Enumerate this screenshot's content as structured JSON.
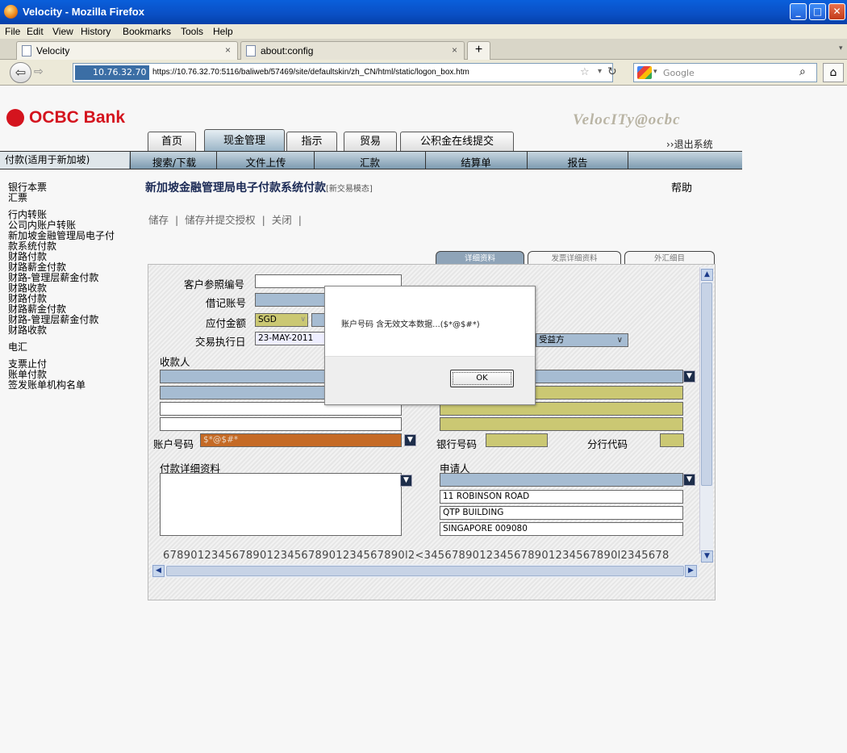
{
  "window": {
    "title": "Velocity - Mozilla Firefox"
  },
  "menu": [
    "File",
    "Edit",
    "View",
    "History",
    "Bookmarks",
    "Tools",
    "Help"
  ],
  "tabs": [
    {
      "label": "Velocity",
      "close": "×"
    },
    {
      "label": "about:config",
      "close": "×"
    }
  ],
  "new_tab": "+",
  "nav": {
    "site_id": "10.76.32.70",
    "url": "https://10.76.32.70:5116/baliweb/57469/site/defaultskin/zh_CN/html/static/logon_box.htm",
    "search_placeholder": "Google"
  },
  "brand": {
    "bank": "OCBC Bank",
    "product": "VelocITy@ocbc"
  },
  "main_tabs": [
    "首页",
    "现金管理",
    "指示",
    "贸易",
    "公积金在线提交"
  ],
  "logout": "››退出系统",
  "subnav": [
    "付款(适用于新加坡)",
    "搜索/下载",
    "文件上传",
    "汇款",
    "结算单",
    "报告"
  ],
  "left_menu": [
    "银行本票",
    "汇票",
    "",
    "行内转账",
    "公司内账户转账",
    "新加坡金融管理局电子付",
    "款系统付款",
    "财路付款",
    "财路薪金付款",
    "财路-管理层薪金付款",
    "财路收款",
    "财路付款",
    "财路薪金付款",
    "财路-管理层薪金付款",
    "财路收款",
    "",
    "电汇",
    "",
    "支票止付",
    "账单付款",
    "签发账单机构名单"
  ],
  "page": {
    "title": "新加坡金融管理局电子付款系统付款",
    "status": "[新交易模态]",
    "help": "帮助"
  },
  "actions": [
    "储存",
    "储存并提交授权",
    "关闭"
  ],
  "content_tabs": [
    "详细资料",
    "发票详细资料",
    "外汇细目"
  ],
  "form": {
    "customer_ref_label": "客户参照编号",
    "debit_account_label": "借记账号",
    "amount_label": "应付金额",
    "currency": "SGD",
    "exec_date_label": "交易执行日",
    "exec_date": "23-MAY-2011",
    "charges_value": "受益方",
    "payee_label": "收款人",
    "account_no_label": "账户号码",
    "account_no_value": "$*@$#*",
    "bank_code_label": "银行号码",
    "branch_code_label": "分行代码",
    "payment_details_label": "付款详细资料",
    "applicant_label": "申请人",
    "applicant_address": [
      "11 ROBINSON ROAD",
      "QTP BUILDING",
      "SINGAPORE 009080"
    ],
    "long_text": "67890123456789012345678901234567890l2<3456789012345678901234567890l2345678"
  },
  "dialog": {
    "message": "账户号码 含无效文本数据...($*@$#*)",
    "ok": "OK"
  }
}
